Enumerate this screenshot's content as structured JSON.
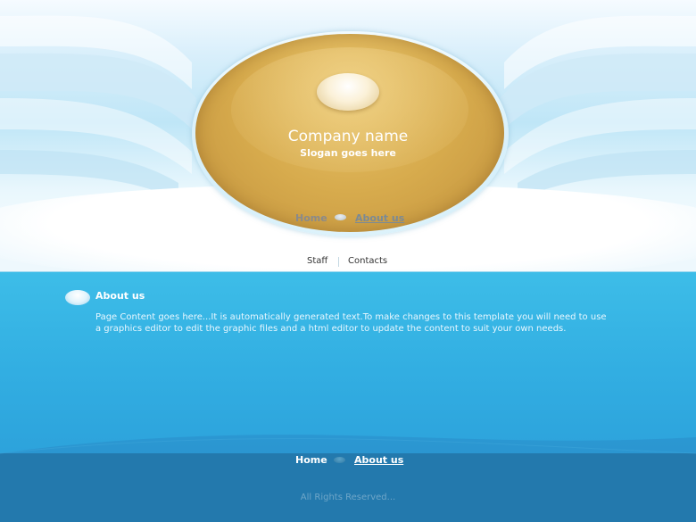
{
  "header": {
    "company_name": "Company name",
    "slogan": "Slogan goes here"
  },
  "top_nav": {
    "home": "Home",
    "about": "About us"
  },
  "sub_nav": {
    "staff": "Staff",
    "contacts": "Contacts"
  },
  "main": {
    "title": "About us",
    "body": "Page Content goes here...It is automatically generated text.To make changes to this template you will need to use a graphics editor to edit the graphic files and a html editor to update the content to suit your own needs."
  },
  "footer": {
    "home": "Home",
    "about": "About us",
    "copyright": "All Rights Reserved..."
  },
  "colors": {
    "gold": "#d7ab4d",
    "content_blue": "#32aee2",
    "footer_blue": "#2379ad",
    "header_light": "#d9effb"
  }
}
